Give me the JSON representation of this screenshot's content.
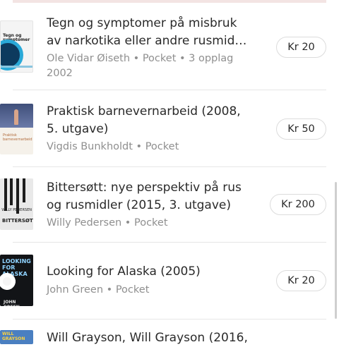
{
  "items": [
    {
      "title_line1": "Tegn og symptomer på misbruk",
      "title_line2": "av narkotika eller andre rusmid…",
      "meta_line1": "Ole Vidar Øiseth • Pocket • 3 opplag",
      "meta_line2": "2002",
      "price": "Kr 20",
      "cover_text": "Tegn og symptomer"
    },
    {
      "title_line1": "Praktisk barnevernarbeid (2008,",
      "title_line2": "5. utgave)",
      "meta_line1": "Vigdis Bunkholdt • Pocket",
      "price": "Kr 50",
      "cover_text": "Praktisk barnevernarbeid"
    },
    {
      "title_line1": "Bittersøtt: nye perspektiv på rus",
      "title_line2": "og rusmidler (2015, 3. utgave)",
      "meta_line1": "Willy Pedersen • Pocket",
      "price": "Kr 200",
      "cover_author": "WILLY PEDERSEN",
      "cover_title": "BITTERSØTT"
    },
    {
      "title_line1": "Looking for Alaska (2005)",
      "meta_line1": "John Green • Pocket",
      "price": "Kr 20",
      "cover_title": "LOOKING FOR ALASKA",
      "cover_author": "JOHN GREEN"
    },
    {
      "title_line1": "Will Grayson, Will Grayson (2016,",
      "cover_title": "WILL GRAYSON"
    }
  ]
}
